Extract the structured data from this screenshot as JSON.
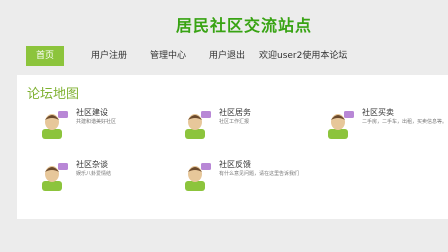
{
  "header": {
    "title": "居民社区交流站点"
  },
  "nav": {
    "items": [
      "首页",
      "用户注册",
      "管理中心",
      "用户退出"
    ],
    "welcome": "欢迎user2使用本论坛"
  },
  "main": {
    "section_title": "论坛地图",
    "forums": [
      {
        "name": "社区建设",
        "desc": "共建和谐美好社区"
      },
      {
        "name": "社区居务",
        "desc": "社区工作汇报"
      },
      {
        "name": "社区买卖",
        "desc": "二手房，二手车，出租，买卖信息等。"
      },
      {
        "name": "社区杂谈",
        "desc": "娱乐八卦爱情结"
      },
      {
        "name": "社区反馈",
        "desc": "有什么意见问题，请在这里告诉我们"
      }
    ]
  },
  "colors": {
    "accent": "#38a313",
    "nav_active": "#8cc43c",
    "section": "#7fb131"
  }
}
